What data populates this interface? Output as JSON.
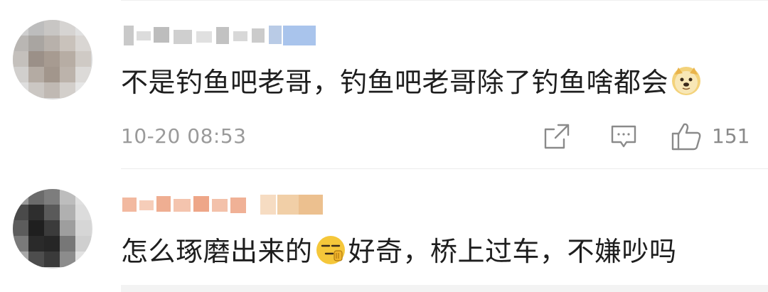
{
  "comments": [
    {
      "text_before": "不是钓鱼吧老哥，钓鱼吧老哥除了钓鱼啥都会",
      "emoji_after": "doge-emoji",
      "timestamp": "10-20 08:53",
      "likes": "151"
    },
    {
      "text_before": "怎么琢磨出来的",
      "emoji_middle": "thinking-emoji",
      "text_after": "好奇，桥上过车，不嫌吵吗"
    }
  ],
  "icons": {
    "share": "share-icon",
    "reply": "comment-icon",
    "like": "thumbs-up-icon"
  },
  "colors": {
    "text": "#1e1e1e",
    "meta": "#9a9a9a",
    "icon": "#8a8a8a",
    "emoji": "#f5c73a"
  }
}
